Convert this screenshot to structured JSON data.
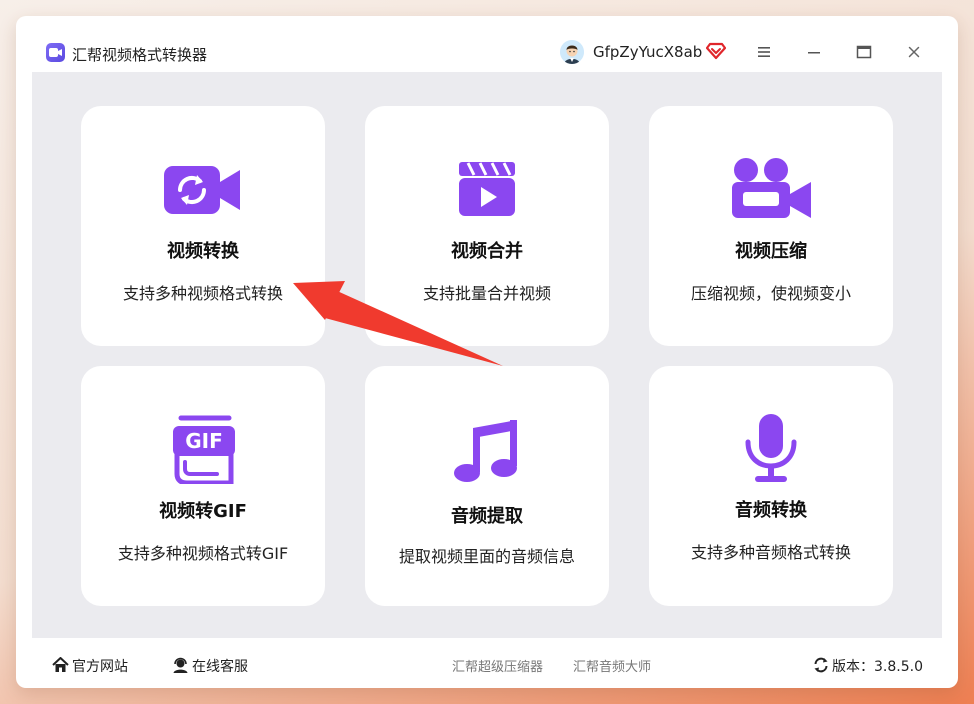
{
  "app": {
    "title": "汇帮视频格式转换器"
  },
  "user": {
    "name": "GfpZyYucX8ab"
  },
  "cards": [
    {
      "title": "视频转换",
      "desc": "支持多种视频格式转换"
    },
    {
      "title": "视频合并",
      "desc": "支持批量合并视频"
    },
    {
      "title": "视频压缩",
      "desc": "压缩视频，使视频变小"
    },
    {
      "title": "视频转GIF",
      "desc": "支持多种视频格式转GIF",
      "icon_text": "GIF"
    },
    {
      "title": "音频提取",
      "desc": "提取视频里面的音频信息"
    },
    {
      "title": "音频转换",
      "desc": "支持多种音频格式转换"
    }
  ],
  "footer": {
    "official_site": "官方网站",
    "online_service": "在线客服",
    "link1": "汇帮超级压缩器",
    "link2": "汇帮音频大师",
    "version": "版本：3.8.5.0"
  },
  "colors": {
    "accent": "#8b47f0",
    "arrow": "#f03a2e",
    "background": "#ebebef"
  }
}
